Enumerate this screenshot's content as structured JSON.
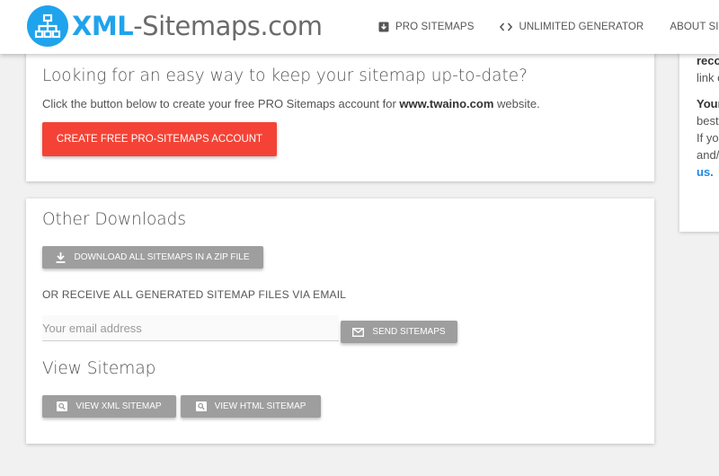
{
  "header": {
    "logo": {
      "brand": "XML",
      "rest": "-Sitemaps.com"
    },
    "nav": [
      {
        "label": "PRO SITEMAPS",
        "icon": "archive-box-icon"
      },
      {
        "label": "UNLIMITED GENERATOR",
        "icon": "code-brackets-icon"
      },
      {
        "label": "ABOUT SITEMAPS",
        "icon": ""
      }
    ]
  },
  "side_card": {
    "lines": [
      "reco",
      "link c",
      "Your",
      "best",
      "If yo",
      "and/",
      "us."
    ]
  },
  "pro_card": {
    "heading": "Looking for an easy way to keep your sitemap up-to-date?",
    "text_before": "Click the button below to create your free PRO Sitemaps account for ",
    "site": "www.twaino.com",
    "text_after": " website.",
    "cta_label": "CREATE FREE PRO-SITEMAPS ACCOUNT"
  },
  "downloads_card": {
    "heading": "Other Downloads",
    "zip_label": "DOWNLOAD ALL SITEMAPS IN A ZIP FILE",
    "email_caption": "OR RECEIVE ALL GENERATED SITEMAP FILES VIA EMAIL",
    "email_placeholder": "Your email address",
    "send_label": "SEND SITEMAPS",
    "view_heading": "View Sitemap",
    "view_xml_label": "VIEW XML SITEMAP",
    "view_html_label": "VIEW HTML SITEMAP"
  },
  "colors": {
    "brand_blue": "#1fa3ec",
    "cta_red": "#f44336",
    "button_grey": "#9e9e9e",
    "link_blue": "#1e88e5"
  }
}
